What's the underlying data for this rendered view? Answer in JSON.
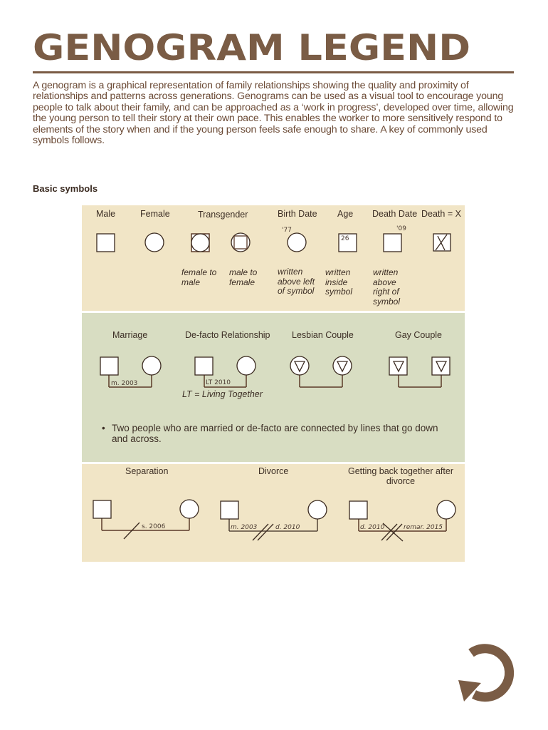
{
  "header": {
    "title": "GENOGRAM LEGEND",
    "intro": "A genogram is a graphical representation of family relationships showing the quality and proximity of relationships and patterns across generations. Genograms can be used as a visual tool to encourage young people to talk about their family, and can be approached as a ‘work in progress’, developed over time, allowing the young person to tell their story at their own pace. This enables the worker to more sensitively respond to elements of the story when and if the young person feels safe enough to share. A key of commonly used symbols follows."
  },
  "section_heading": "Basic symbols",
  "basic": {
    "male": "Male",
    "female": "Female",
    "transgender": "Transgender",
    "birth_date": "Birth Date",
    "age": "Age",
    "death_date": "Death Date",
    "death_x": "Death = X",
    "ftm_note": "female to male",
    "mtf_note": "male to female",
    "birth_note": "written above left of symbol",
    "age_note": "written inside symbol",
    "death_note": "written above right of symbol",
    "birth_sample": "'77",
    "age_sample": "26",
    "death_sample": "'09"
  },
  "couples": {
    "marriage": "Marriage",
    "defacto": "De-facto Relationship",
    "lesbian": "Lesbian Couple",
    "gay": "Gay Couple",
    "marriage_date": "m. 2003",
    "defacto_date": "LT 2010",
    "lt_note": "LT = Living Together",
    "bullet": "Two people who are married or de-facto are connected by lines that go down and across."
  },
  "breakups": {
    "separation": "Separation",
    "divorce": "Divorce",
    "reunion": "Getting back together after divorce",
    "separation_date": "s. 2006",
    "divorce_m": "m. 2003",
    "divorce_d": "d. 2010",
    "reunion_d": "d. 2010",
    "reunion_r": "remar. 2015"
  },
  "icons": {
    "loop": "circular-arrow-icon"
  },
  "colors": {
    "brand_brown": "#7a5c45",
    "cream": "#f1e5c6",
    "sage": "#d8ddc2"
  }
}
